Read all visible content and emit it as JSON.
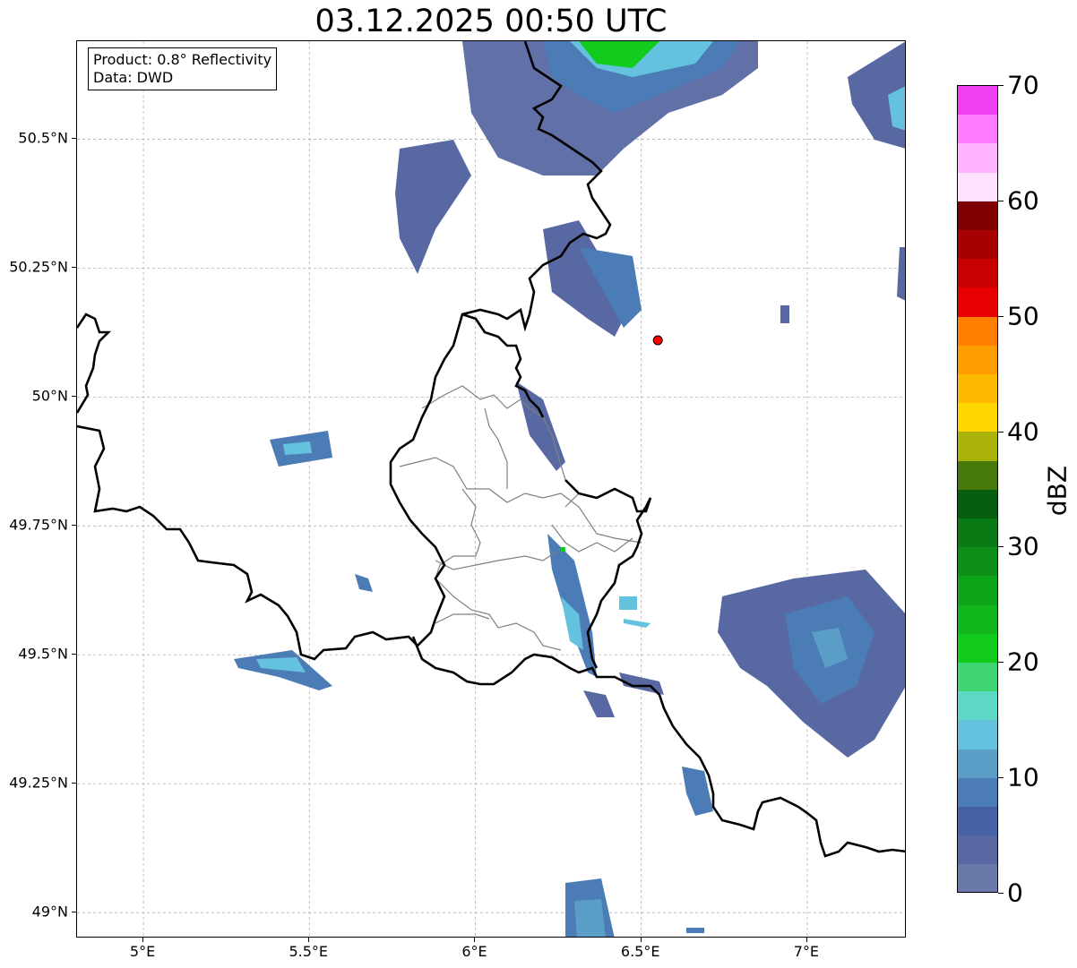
{
  "title": "03.12.2025 00:50 UTC",
  "info": {
    "product": "Product: 0.8° Reflectivity",
    "data": "Data: DWD"
  },
  "axes": {
    "lon_range": [
      4.8,
      7.3
    ],
    "lat_range": [
      48.95,
      50.69
    ],
    "lon_ticks": [
      {
        "value": 5.0,
        "label": "5°E"
      },
      {
        "value": 5.5,
        "label": "5.5°E"
      },
      {
        "value": 6.0,
        "label": "6°E"
      },
      {
        "value": 6.5,
        "label": "6.5°E"
      },
      {
        "value": 7.0,
        "label": "7°E"
      }
    ],
    "lat_ticks": [
      {
        "value": 50.5,
        "label": "50.5°N"
      },
      {
        "value": 50.25,
        "label": "50.25°N"
      },
      {
        "value": 50.0,
        "label": "50°N"
      },
      {
        "value": 49.75,
        "label": "49.75°N"
      },
      {
        "value": 49.5,
        "label": "49.5°N"
      },
      {
        "value": 49.25,
        "label": "49.25°N"
      },
      {
        "value": 49.0,
        "label": "49°N"
      }
    ],
    "grid": true
  },
  "radar_site": {
    "lon": 6.55,
    "lat": 50.11,
    "color": "#ff0000"
  },
  "colorbar": {
    "label": "dBZ",
    "min": 0,
    "max": 70,
    "ticks": [
      {
        "value": 0,
        "label": "0"
      },
      {
        "value": 10,
        "label": "10"
      },
      {
        "value": 20,
        "label": "20"
      },
      {
        "value": 30,
        "label": "30"
      },
      {
        "value": 40,
        "label": "40"
      },
      {
        "value": 50,
        "label": "50"
      },
      {
        "value": 60,
        "label": "60"
      },
      {
        "value": 70,
        "label": "70"
      }
    ],
    "colors": [
      "#6a79a9",
      "#5868a2",
      "#4562a6",
      "#4c7cb5",
      "#5a9ec8",
      "#64c2de",
      "#5cd8c5",
      "#3ed572",
      "#11cc1c",
      "#10b61c",
      "#0ea41a",
      "#0c8e17",
      "#0a7a14",
      "#085e10",
      "#477a0b",
      "#aab30a",
      "#ffd700",
      "#ffb800",
      "#ff9c00",
      "#ff7f00",
      "#e60000",
      "#c70000",
      "#a80000",
      "#7f0000",
      "#ffe0ff",
      "#ffb3ff",
      "#ff7bff",
      "#ee40f0"
    ]
  },
  "echo_colors": {
    "weak": "#5868a2",
    "light": "#4c7cb5",
    "moderate": "#64c2de",
    "strong": "#11cc1c"
  }
}
